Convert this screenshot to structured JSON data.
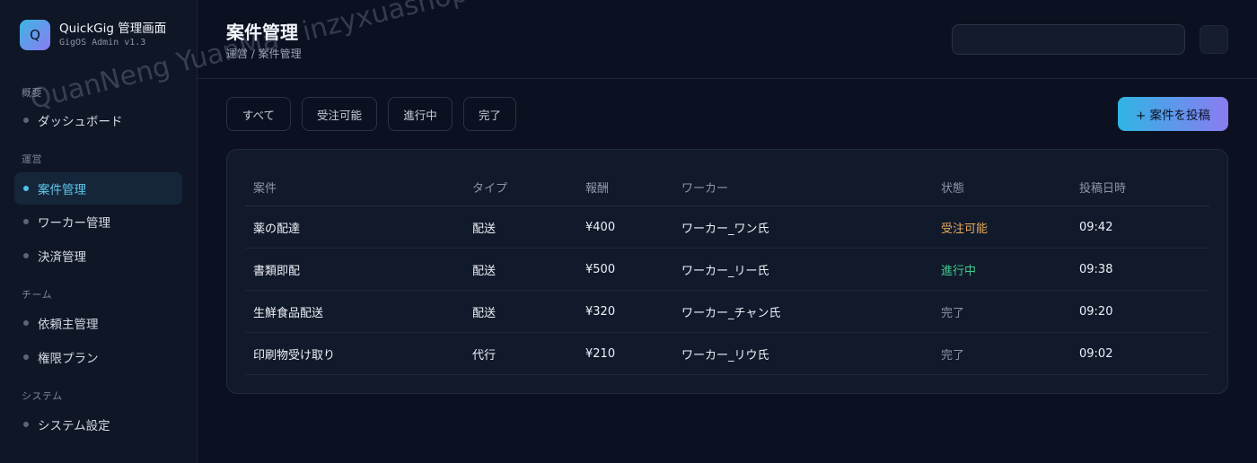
{
  "brand": {
    "logo_letter": "Q",
    "title": "QuickGig 管理画面",
    "subtitle": "GigOS Admin v1.3"
  },
  "sidebar": {
    "sections": [
      {
        "label": "概要",
        "items": [
          {
            "label": "ダッシュボード",
            "active": false
          }
        ]
      },
      {
        "label": "運営",
        "items": [
          {
            "label": "案件管理",
            "active": true
          },
          {
            "label": "ワーカー管理",
            "active": false
          },
          {
            "label": "決済管理",
            "active": false
          }
        ]
      },
      {
        "label": "チーム",
        "items": [
          {
            "label": "依頼主管理",
            "active": false
          },
          {
            "label": "権限プラン",
            "active": false
          }
        ]
      },
      {
        "label": "システム",
        "items": [
          {
            "label": "システム設定",
            "active": false
          }
        ]
      }
    ]
  },
  "header": {
    "title": "案件管理",
    "breadcrumb": "運営 / 案件管理",
    "search_value": "",
    "search_placeholder": ""
  },
  "filters": [
    "すべて",
    "受注可能",
    "進行中",
    "完了"
  ],
  "post_button": "+ 案件を投稿",
  "table": {
    "columns": [
      "案件",
      "タイプ",
      "報酬",
      "ワーカー",
      "状態",
      "投稿日時"
    ],
    "rows": [
      {
        "title": "薬の配達",
        "type": "配送",
        "reward": "¥400",
        "worker": "ワーカー_ワン氏",
        "status": "受注可能",
        "status_kind": "open",
        "posted": "09:42"
      },
      {
        "title": "書類即配",
        "type": "配送",
        "reward": "¥500",
        "worker": "ワーカー_リー氏",
        "status": "進行中",
        "status_kind": "progress",
        "posted": "09:38"
      },
      {
        "title": "生鮮食品配送",
        "type": "配送",
        "reward": "¥320",
        "worker": "ワーカー_チャン氏",
        "status": "完了",
        "status_kind": "done",
        "posted": "09:20"
      },
      {
        "title": "印刷物受け取り",
        "type": "代行",
        "reward": "¥210",
        "worker": "ワーカー_リウ氏",
        "status": "完了",
        "status_kind": "done",
        "posted": "09:02"
      }
    ]
  },
  "colors": {
    "accent": "#4cc3ea",
    "status_open": "#e8a95a",
    "status_progress": "#3fcf8e",
    "status_done": "#8a93a6"
  },
  "watermark": "QuanNeng YuanMa · inzyxuashop.com"
}
